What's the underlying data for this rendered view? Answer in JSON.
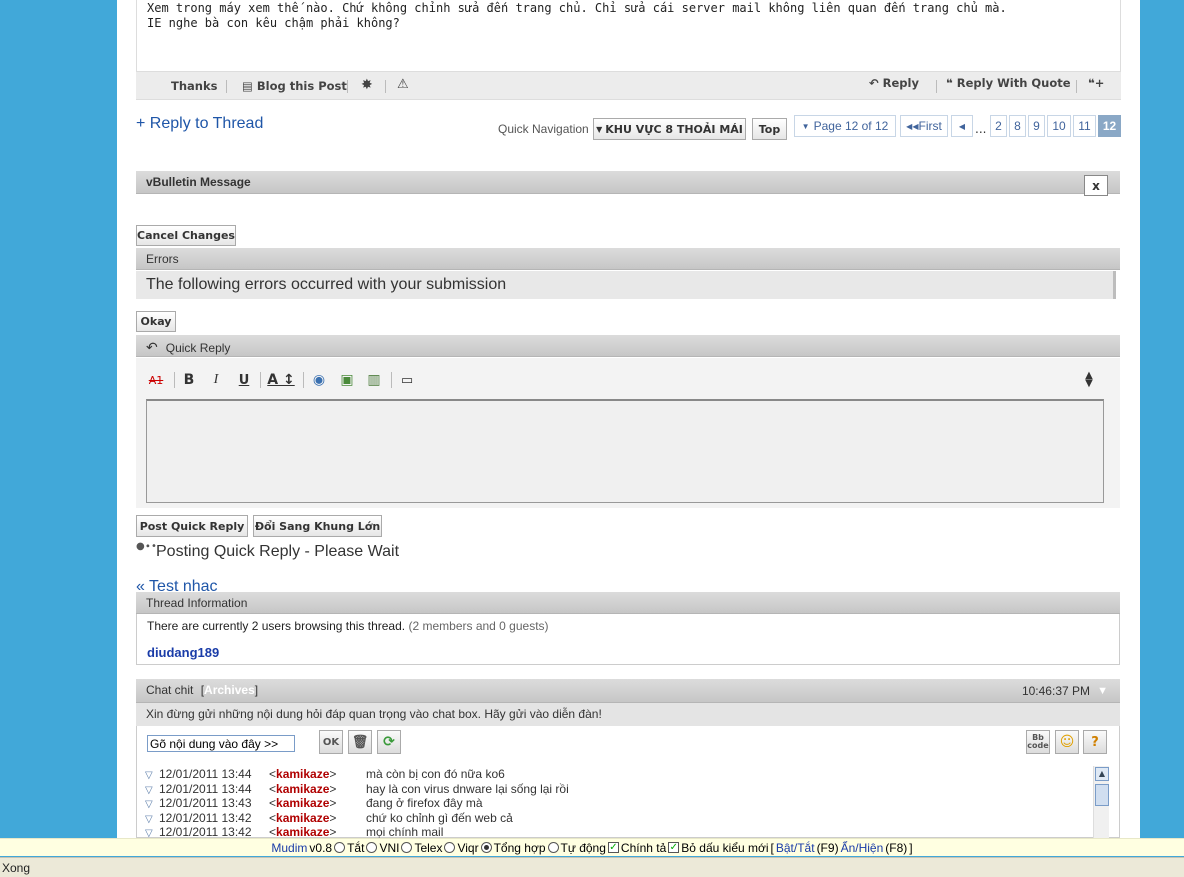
{
  "post": {
    "line1": "Xem trong máy xem thế nào. Chứ không chỉnh sửa đến trang chủ. Chỉ sửa cái server mail không liên quan đến trang chủ mà.",
    "line2": "IE nghe bà con kêu chậm phải không?",
    "thanks": "Thanks",
    "blog": "Blog this Post",
    "reply": "Reply",
    "reply_quote": "Reply With Quote"
  },
  "nav": {
    "reply_thread": "+ Reply to Thread",
    "quick_nav_label": "Quick Navigation",
    "forum_select": "KHU VỰC 8 THOẢI MÁI",
    "top": "Top",
    "page_of": "Page 12 of 12",
    "first": "First",
    "ellipsis": "...",
    "pages": [
      "2",
      "8",
      "9",
      "10",
      "11",
      "12"
    ]
  },
  "vb_message": {
    "title": "vBulletin Message",
    "close": "x"
  },
  "errors": {
    "cancel": "Cancel Changes",
    "header": "Errors",
    "message": "The following errors occurred with your submission",
    "okay": "Okay"
  },
  "quick_reply": {
    "header": "Quick Reply",
    "post_button": "Post Quick Reply",
    "switch_button": "Đổi Sang Khung Lớn",
    "posting": "Posting Quick Reply - Please Wait"
  },
  "prev_thread": "« Test nhạc",
  "thread_info": {
    "header": "Thread Information",
    "browsing": "There are currently 2 users browsing this thread.",
    "members": "(2 members and 0 guests)",
    "user": "diudang189"
  },
  "chat": {
    "title": "Chat chit",
    "archives": "Archives",
    "time": "10:46:37 PM",
    "notice": "Xin đừng gửi những nội dung hỏi đáp quan trọng vào chat box. Hãy gửi vào diễn đàn!",
    "input_value": "Gõ nội dung vào đây >>",
    "ok": "OK",
    "bbcode": "Bb code",
    "messages": [
      {
        "time": "12/01/2011 13:44",
        "user": "kamikaze",
        "text": "mà còn bị con đó nữa ko6"
      },
      {
        "time": "12/01/2011 13:44",
        "user": "kamikaze",
        "text": "hay là con virus dnware lại sống lại rồi"
      },
      {
        "time": "12/01/2011 13:43",
        "user": "kamikaze",
        "text": "đang ở firefox đây mà"
      },
      {
        "time": "12/01/2011 13:42",
        "user": "kamikaze",
        "text": "chứ ko chỉnh gì đến web cả"
      },
      {
        "time": "12/01/2011 13:42",
        "user": "kamikaze",
        "text": "mọi chính mail"
      }
    ]
  },
  "mudim": {
    "name": "Mudim",
    "version": "v0.8",
    "opt_off": "Tắt",
    "opt_vni": "VNI",
    "opt_telex": "Telex",
    "opt_viqr": "Viqr",
    "opt_tonghop": "Tổng hợp",
    "opt_tudong": "Tự động",
    "chinh_ta": "Chính tả",
    "bo_dau": "Bỏ dấu kiểu mới",
    "bracket_open": "[",
    "bat_tat": "Bật/Tắt",
    "f9": "(F9)",
    "an_hien": "Ẩn/Hiện",
    "f8": "(F8)",
    "bracket_close": "]"
  },
  "status_bar": "Xong"
}
